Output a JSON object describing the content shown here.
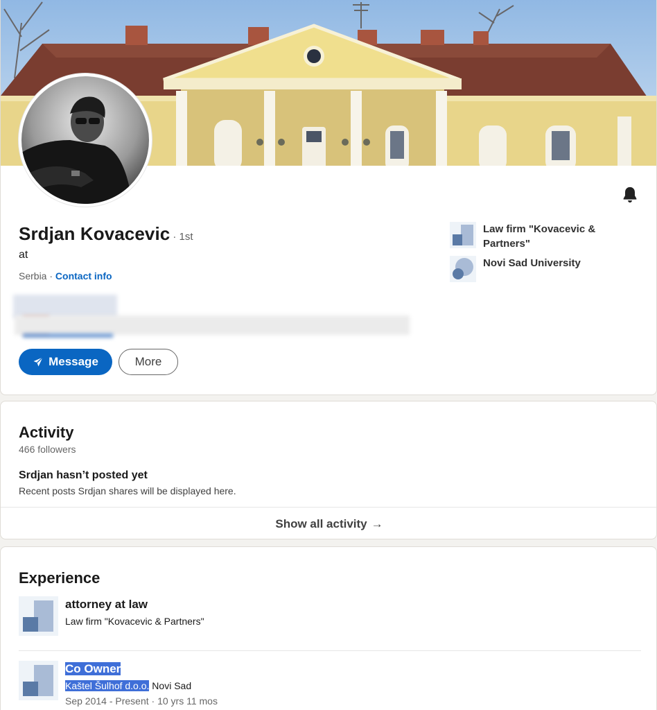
{
  "profile": {
    "name": "Srdjan Kovacevic",
    "degree": "· 1st",
    "headline": "at",
    "location": "Serbia",
    "location_separator": " · ",
    "contact_info": "Contact info",
    "message_button": "Message",
    "more_button": "More",
    "side_items": [
      {
        "label": "Law firm \"Kovacevic & Partners\"",
        "icon": "company-logo"
      },
      {
        "label": "Novi Sad University",
        "icon": "school-logo"
      }
    ]
  },
  "activity": {
    "title": "Activity",
    "followers": "466 followers",
    "not_posted": "Srdjan hasn’t posted yet",
    "recent": "Recent posts Srdjan shares will be displayed here.",
    "show_all": "Show all activity",
    "show_all_arrow": "→"
  },
  "experience": {
    "title": "Experience",
    "items": [
      {
        "title": "attorney at law",
        "company": "Law firm \"Kovacevic & Partners\""
      },
      {
        "title": "Co Owner",
        "company": "Kaštel Šulhof d.o.o.",
        "location": " Novi Sad",
        "dates": "Sep 2014 - Present · 10 yrs 11 mos"
      }
    ]
  },
  "colors": {
    "accent": "#0a66c2",
    "selection": "#3f6fd8",
    "logo_light": "#a9bbd6",
    "logo_dark": "#5a7aa6"
  }
}
